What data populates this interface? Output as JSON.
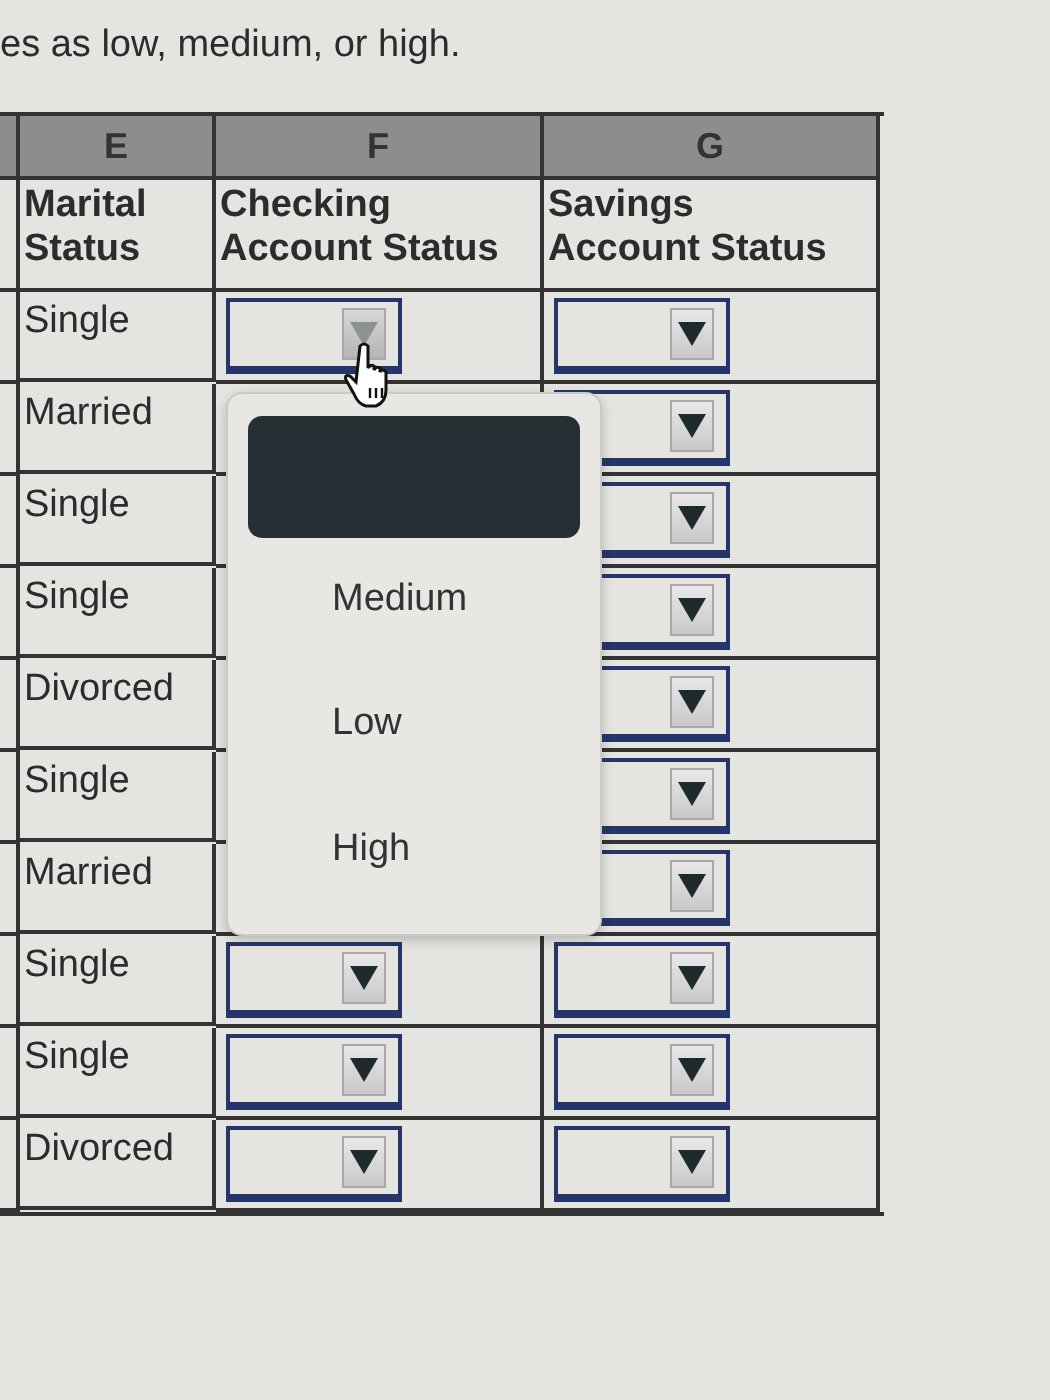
{
  "instruction": "es as low, medium, or high.",
  "columns": [
    {
      "letter": "E",
      "heading": "Marital Status"
    },
    {
      "letter": "F",
      "heading": "Checking Account Status"
    },
    {
      "letter": "G",
      "heading": "Savings Account Status"
    }
  ],
  "rows": [
    {
      "marital": "Single",
      "checking_select": true,
      "checking_pressed": true,
      "savings_select": true
    },
    {
      "marital": "Married",
      "checking_select": false,
      "savings_select": true
    },
    {
      "marital": "Single",
      "checking_select": false,
      "savings_select": true
    },
    {
      "marital": "Single",
      "checking_select": false,
      "savings_select": true
    },
    {
      "marital": "Divorced",
      "checking_select": false,
      "savings_select": true
    },
    {
      "marital": "Single",
      "checking_select": false,
      "savings_select": true
    },
    {
      "marital": "Married",
      "checking_select": false,
      "savings_select": true
    },
    {
      "marital": "Single",
      "checking_select": true,
      "checking_pressed": false,
      "savings_select": true
    },
    {
      "marital": "Single",
      "checking_select": true,
      "checking_pressed": false,
      "savings_select": true
    },
    {
      "marital": "Divorced",
      "checking_select": true,
      "checking_pressed": false,
      "savings_select": true
    }
  ],
  "dropdown": {
    "blank_option_highlighted": true,
    "options": [
      {
        "label": "Medium",
        "selected": false
      },
      {
        "label": "Low",
        "selected": false
      },
      {
        "label": "High",
        "selected": false
      }
    ]
  }
}
